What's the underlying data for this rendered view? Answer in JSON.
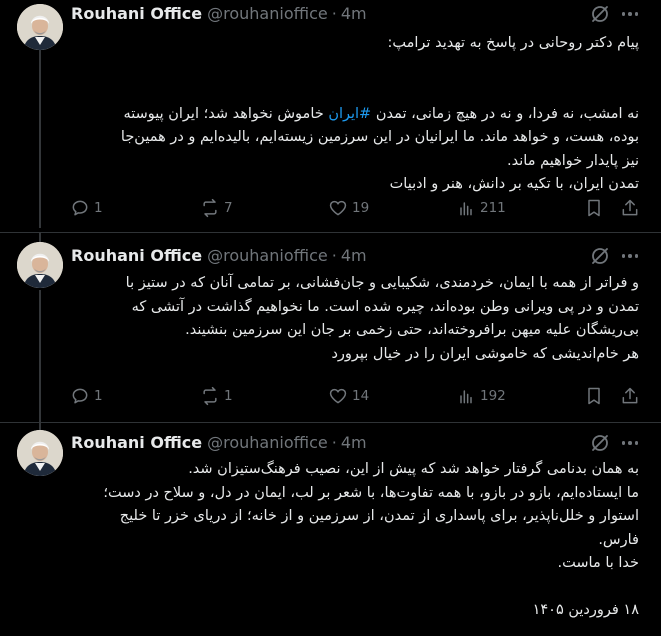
{
  "author": {
    "name": "Rouhani Office",
    "handle": "@rouhanioffice",
    "separator": "·"
  },
  "tweets": [
    {
      "time": "4m",
      "lines": [
        "پیام دکتر روحانی در پاسخ به تهدید ترامپ:",
        "",
        "",
        "نه امشب، نه فردا، و نه در هیچ زمانی، تمدن #ایران خاموش نخواهد شد؛ ایران پیوسته",
        "بوده، هست، و خواهد ماند. ما ایرانیان در این سرزمین زیسته‌ایم، بالیده‌ایم و در همین‌جا",
        "نیز پایدار خواهیم ماند.",
        "تمدن ایران، با تکیه بر دانش، هنر و ادبیات"
      ],
      "hashtag": "#ایران",
      "replies": "1",
      "reposts": "7",
      "likes": "19",
      "views": "211"
    },
    {
      "time": "4m",
      "lines": [
        "و فراتر از همه با ایمان، خردمندی، شکیبایی و جان‌فشانی، بر تمامی آنان که در ستیز با",
        "تمدن و در پی ویرانی وطن بوده‌اند، چیره شده است. ما نخواهیم گذاشت در آتشی که",
        "بی‌ریشگان علیه میهن برافروخته‌اند، حتی زخمی بر جان این سرزمین بنشیند.",
        "هر خام‌اندیشی که خاموشی ایران را در خیال بپرورد"
      ],
      "replies": "1",
      "reposts": "1",
      "likes": "14",
      "views": "192"
    },
    {
      "time": "4m",
      "lines": [
        "به همان بدنامی گرفتار خواهد شد که پیش از این، نصیب فرهنگ‌ستیزان شد.",
        "ما ایستاده‌ایم، بازو در بازو، با همه تفاوت‌ها، با شعر بر لب، ایمان در دل، و سلاح در دست؛",
        "استوار و خلل‌ناپذیر، برای پاسداری از تمدن، از سرزمین و از خانه؛ از دریای خزر تا خلیج",
        "فارس.",
        "خدا با ماست.",
        "",
        "۱۸ فروردین ۱۴۰۵"
      ]
    }
  ],
  "icons": {
    "reply": "reply-icon",
    "repost": "repost-icon",
    "like": "heart-icon",
    "views": "views-icon",
    "bookmark": "bookmark-icon",
    "share": "share-icon",
    "grok": "grok-icon",
    "more": "more-icon"
  },
  "colors": {
    "background": "#000000",
    "text": "#e7e9ea",
    "muted": "#71767b",
    "link": "#1d9bf0",
    "divider": "#2f3336"
  }
}
